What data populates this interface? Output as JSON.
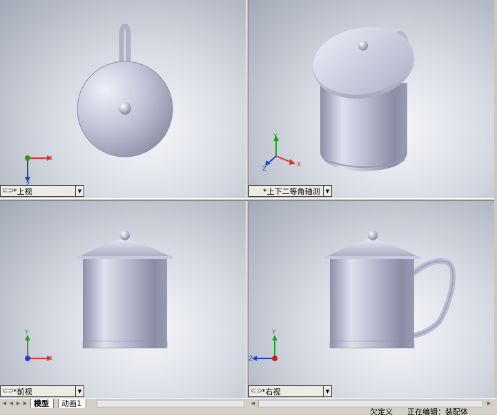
{
  "views": {
    "top": {
      "label": "*上视"
    },
    "isometric": {
      "label": "*上下二等角轴测"
    },
    "front": {
      "label": "*前视"
    },
    "right": {
      "label": "*右视"
    }
  },
  "triad": {
    "x": "X",
    "y": "Y",
    "z": "Z"
  },
  "tabs": [
    {
      "label": "模型",
      "active": true
    },
    {
      "label": "动画1",
      "active": false
    }
  ],
  "status": {
    "items": [
      "欠定义",
      "正在编辑：装配体"
    ]
  },
  "icons": {
    "link": "link-chain-icon",
    "dropdown": "chevron-down-icon"
  },
  "colors": {
    "axis_x": "#e03030",
    "axis_y": "#20a020",
    "axis_z": "#2040d0",
    "model_body": "#c6c7dc",
    "window_bg": "#d4d0c8"
  }
}
